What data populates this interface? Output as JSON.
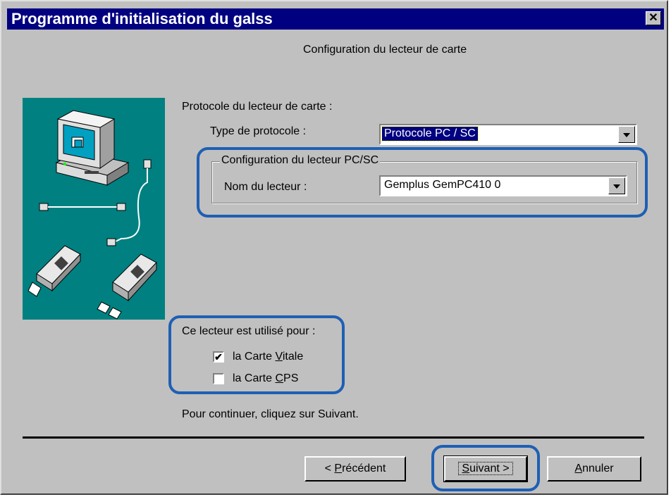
{
  "window": {
    "title": "Programme d'initialisation du galss",
    "close_glyph": "✕"
  },
  "heading": "Configuration du lecteur de carte",
  "protocol_section": {
    "label": "Protocole du lecteur de carte :",
    "type_label": "Type de protocole :",
    "type_value": "Protocole PC / SC"
  },
  "pcsc_group": {
    "title": "Configuration du lecteur PC/SC",
    "reader_label": "Nom du lecteur :",
    "reader_value": "Gemplus GemPC410 0"
  },
  "usage": {
    "label": "Ce lecteur est utilisé pour :",
    "options": [
      {
        "prefix": "la Carte ",
        "accel": "V",
        "suffix": "itale",
        "checked": true
      },
      {
        "prefix": "la Carte ",
        "accel": "C",
        "suffix": "PS",
        "checked": false
      }
    ]
  },
  "continue_text": "Pour continuer, cliquez sur Suivant.",
  "buttons": {
    "previous": {
      "prefix": "< ",
      "accel": "P",
      "suffix": "récédent"
    },
    "next": {
      "prefix": "",
      "accel": "S",
      "suffix": "uivant >"
    },
    "cancel": {
      "prefix": "",
      "accel": "A",
      "suffix": "nnuler"
    }
  },
  "colors": {
    "highlight": "#1e5fb4",
    "titlebar": "#000080",
    "illustration_bg": "#008080"
  },
  "icons": [
    "computer-icon",
    "cable-icon",
    "card-reader-icon"
  ]
}
